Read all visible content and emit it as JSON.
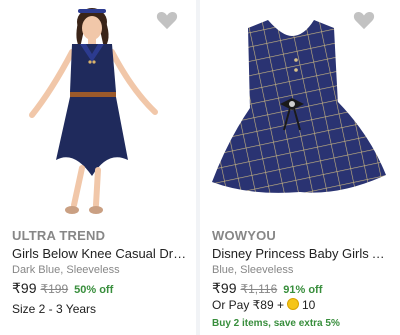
{
  "products": [
    {
      "brand": "ULTRA TREND",
      "title": "Girls Below Knee Casual Dress",
      "variant": "Dark Blue, Sleeveless",
      "price": "₹99",
      "mrp": "₹199",
      "discount": "50% off",
      "size": "Size 2 - 3 Years",
      "wishlist_icon": "heart-icon"
    },
    {
      "brand": "WOWYOU",
      "title": "Disney Princess Baby Girls Above...",
      "variant": "Blue, Sleeveless",
      "price": "₹99",
      "mrp": "₹1,116",
      "discount": "91% off",
      "pay_prefix": "Or Pay ₹89 +",
      "coin_value": "10",
      "offer": "Buy 2 items, save extra 5%",
      "wishlist_icon": "heart-icon"
    }
  ],
  "colors": {
    "discount": "#388e3c",
    "muted": "#878787",
    "dress": "#1f2a5c"
  }
}
